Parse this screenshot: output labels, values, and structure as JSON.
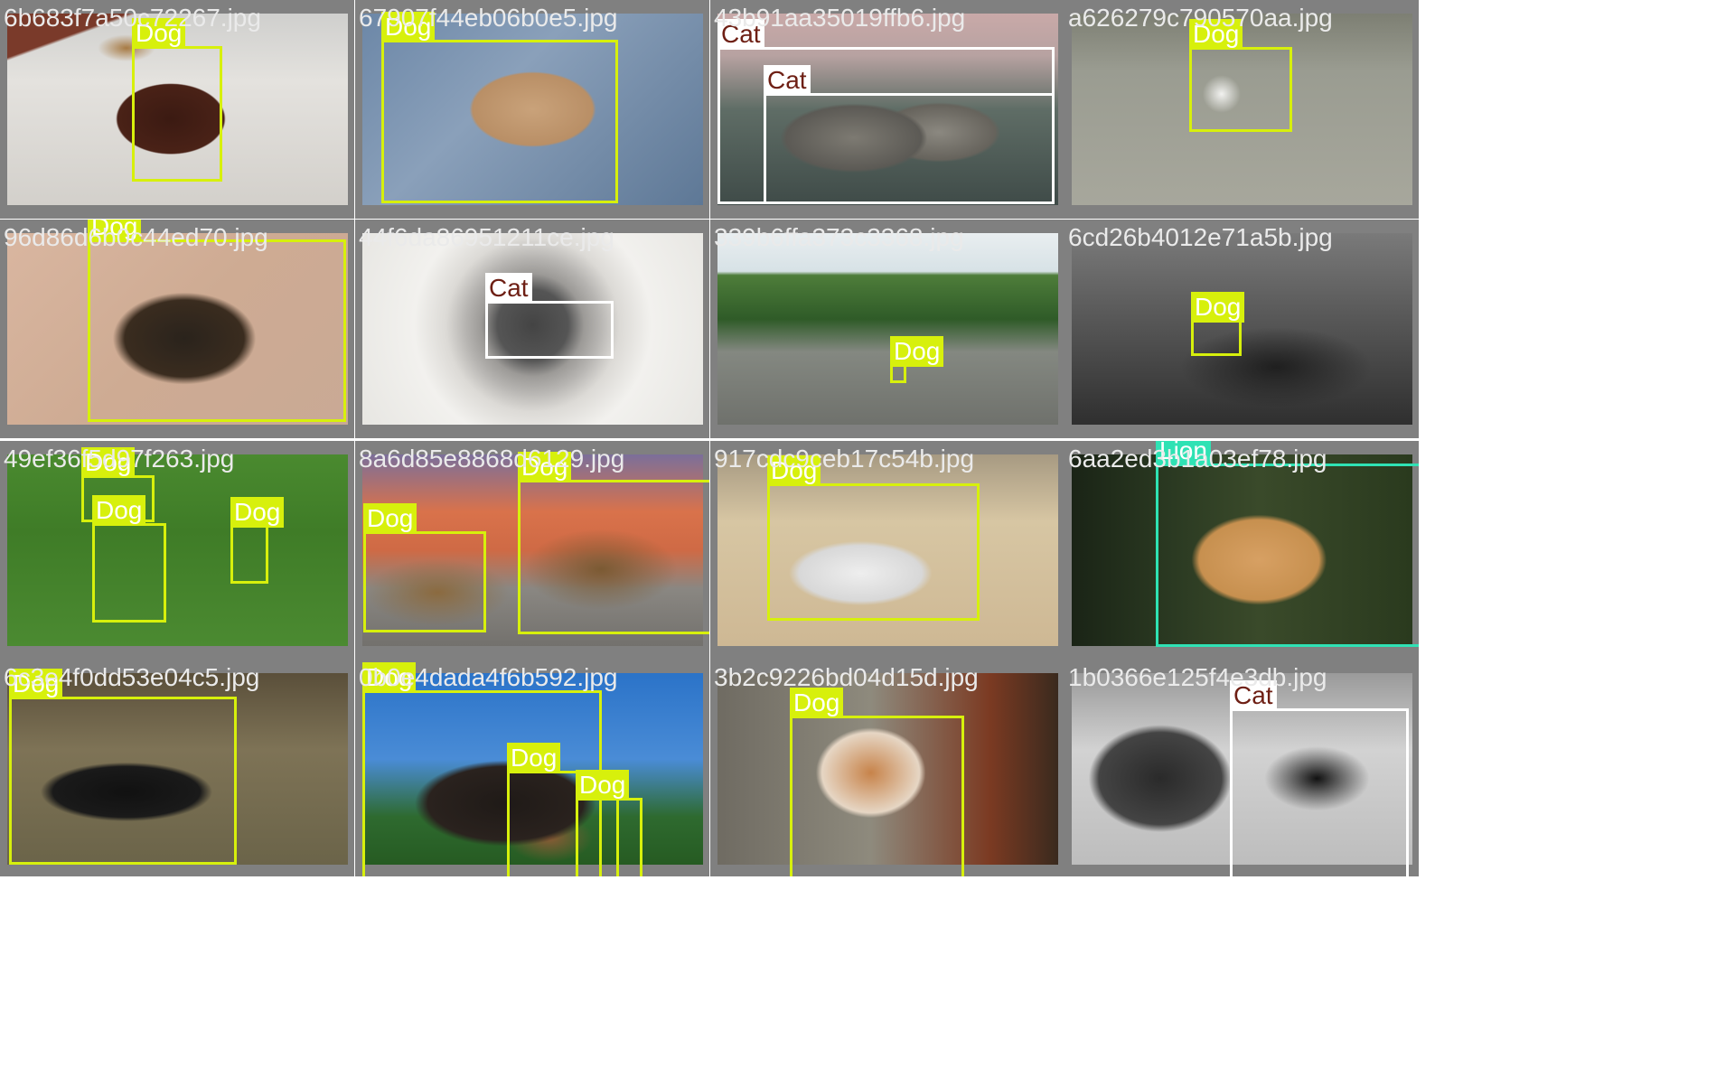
{
  "colors": {
    "dog": "#d7f00c",
    "cat": "#ffffff",
    "lion": "#2fe2b4",
    "tile_bg": "#808080"
  },
  "tiles": [
    {
      "filename": "6b683f7a50c72267.jpg",
      "scene": "dog on beige carpet indoors",
      "detections": [
        {
          "class": "Dog"
        }
      ]
    },
    {
      "filename": "67907f44eb06b0e5.jpg",
      "scene": "pug puppy lying on blue denim",
      "detections": [
        {
          "class": "Dog"
        }
      ]
    },
    {
      "filename": "43b91aa35019ffb6.jpg",
      "scene": "tabby cats sleeping together",
      "detections": [
        {
          "class": "Cat"
        },
        {
          "class": "Cat"
        }
      ]
    },
    {
      "filename": "a626279c790570aa.jpg",
      "scene": "small white dog walking on pavement",
      "detections": [
        {
          "class": "Dog"
        }
      ]
    },
    {
      "filename": "96d86d6b0c44ed70.jpg",
      "scene": "german shepherd dog portrait",
      "detections": [
        {
          "class": "Dog"
        }
      ]
    },
    {
      "filename": "44f6da86951211ce.jpg",
      "scene": "black cat inside tumble dryer drum",
      "detections": [
        {
          "class": "Cat"
        }
      ]
    },
    {
      "filename": "339b6ffa373c3368.jpg",
      "scene": "roadside with caravan, people and a small dog",
      "detections": [
        {
          "class": "Dog"
        }
      ]
    },
    {
      "filename": "6cd26b4012e71a5b.jpg",
      "scene": "people on a motorcycle sidecar with a dog",
      "detections": [
        {
          "class": "Dog"
        }
      ]
    },
    {
      "filename": "49ef36f5d97f263.jpg",
      "scene": "dogs playing on green grass",
      "detections": [
        {
          "class": "Dog"
        },
        {
          "class": "Dog"
        },
        {
          "class": "Dog"
        }
      ]
    },
    {
      "filename": "8a6d85e8868d6129.jpg",
      "scene": "two german shepherds lying on pavement",
      "detections": [
        {
          "class": "Dog"
        },
        {
          "class": "Dog"
        }
      ]
    },
    {
      "filename": "917cdc9ceb17c54b.jpg",
      "scene": "husky lying on sand",
      "detections": [
        {
          "class": "Dog"
        }
      ]
    },
    {
      "filename": "6aa2ed3b1a03ef78.jpg",
      "scene": "cougar lying near forest",
      "detections": [
        {
          "class": "Lion"
        }
      ]
    },
    {
      "filename": "6c3e4f0dd53e04c5.jpg",
      "scene": "black dog walking on dry grass",
      "detections": [
        {
          "class": "Dog"
        }
      ]
    },
    {
      "filename": "0b0e4dada4f6b592.jpg",
      "scene": "three dogs under blue sky",
      "detections": [
        {
          "class": "Dog"
        },
        {
          "class": "Dog"
        },
        {
          "class": "Dog"
        }
      ]
    },
    {
      "filename": "3b2c9226bd04d15d.jpg",
      "scene": "spaniel licking nose by fence",
      "detections": [
        {
          "class": "Dog"
        }
      ]
    },
    {
      "filename": "1b0366e125f4e3db.jpg",
      "scene": "woman holding a black and white cat",
      "detections": [
        {
          "class": "Cat"
        }
      ]
    }
  ]
}
